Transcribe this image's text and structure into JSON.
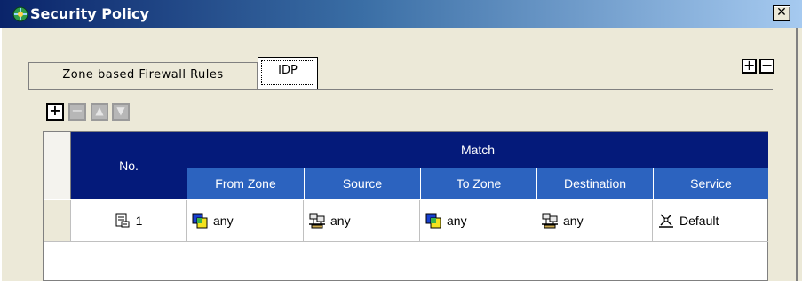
{
  "window": {
    "title": "Security Policy",
    "close_label": "✕"
  },
  "tabs": [
    {
      "label": "Zone based Firewall Rules",
      "selected": false
    },
    {
      "label": "IDP",
      "selected": true
    }
  ],
  "view_controls": {
    "expand_label": "+",
    "collapse_label": "−"
  },
  "toolbar": {
    "add_label": "+",
    "remove_label": "−",
    "move_up_label": "▲",
    "move_down_label": "▼",
    "add_enabled": true,
    "remove_enabled": false,
    "move_up_enabled": false,
    "move_down_enabled": false
  },
  "table": {
    "header": {
      "no": "No.",
      "group": "Match",
      "columns": [
        "From Zone",
        "Source",
        "To Zone",
        "Destination",
        "Service"
      ]
    },
    "rows": [
      {
        "no": "1",
        "from_zone": "any",
        "source": "any",
        "to_zone": "any",
        "destination": "any",
        "service": "Default"
      }
    ]
  },
  "colors": {
    "header_dark": "#041a7a",
    "header_light": "#2c63bf",
    "window_bg": "#ece9d8"
  },
  "icons": {
    "row_no": "policy-rule-icon",
    "zone": "zone-icon",
    "address": "network-hosts-icon",
    "service": "service-icon"
  }
}
